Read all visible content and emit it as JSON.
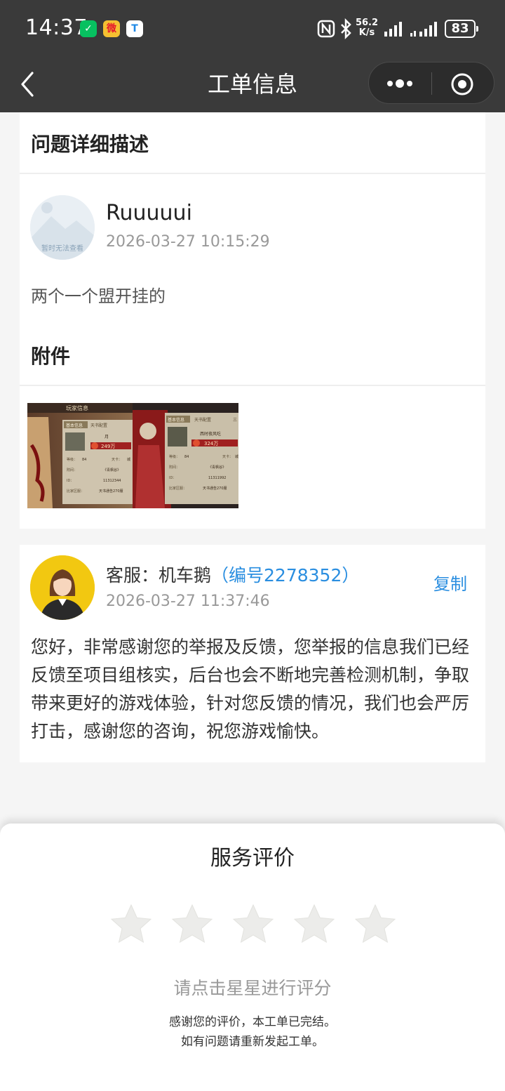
{
  "status_bar": {
    "time": "14:37",
    "net_speed_value": "56.2",
    "net_speed_unit": "K/s",
    "battery": "83",
    "app_icons": [
      "wechat-icon",
      "weibo-icon",
      "tool-icon"
    ],
    "app_icon_glyphs": [
      "✓",
      "微",
      "T"
    ]
  },
  "nav": {
    "title": "工单信息"
  },
  "ticket": {
    "section_title": "问题详细描述",
    "user": {
      "name": "Ruuuuui",
      "time": "2026-03-27 10:15:29",
      "avatar_placeholder": "暂时无法查看"
    },
    "description": "两个一个盟开挂的",
    "attachment_title": "附件",
    "attachment": {
      "panel_a": {
        "header": "玩家信息",
        "tabs": [
          "基本信息",
          "天书配置"
        ],
        "name": "月",
        "score": "249万",
        "level_label": "等级：",
        "level": "84",
        "card_label": "天卡：",
        "card": "城",
        "guild_label": "附间：",
        "guild": "《青枫谷》",
        "id_label": "ID：",
        "id": "11312344",
        "rank_label": "比家区服：",
        "rank": "天书通告270服"
      },
      "panel_b": {
        "tabs": [
          "基本信息",
          "天书配置",
          "三"
        ],
        "name": "西时夜风吃",
        "score": "324万",
        "level_label": "等级：",
        "level": "84",
        "card_label": "天卡：",
        "card": "城",
        "guild_label": "附间：",
        "guild": "《青枫谷》",
        "id_label": "ID：",
        "id": "11311992",
        "rank_label": "比家区服：",
        "rank": "天书通告270服"
      }
    }
  },
  "reply": {
    "agent_prefix": "客服：机车鹅",
    "agent_id": "（编号2278352）",
    "copy_label": "复制",
    "time": "2026-03-27 11:37:46",
    "content": "您好，非常感谢您的举报及反馈，您举报的信息我们已经反馈至项目组核实，后台也会不断地完善检测机制，争取带来更好的游戏体验，针对您反馈的情况，我们也会严厉打击，感谢您的咨询，祝您游戏愉快。"
  },
  "rating": {
    "title": "服务评价",
    "stars": 5,
    "selected": 0,
    "hint": "请点击星星进行评分",
    "note_line1": "感谢您的评价，本工单已完结。",
    "note_line2": "如有问题请重新发起工单。"
  },
  "colors": {
    "header_bg": "#3a3a3a",
    "link": "#2a8ee0",
    "page_bg": "#f5f5f5"
  }
}
